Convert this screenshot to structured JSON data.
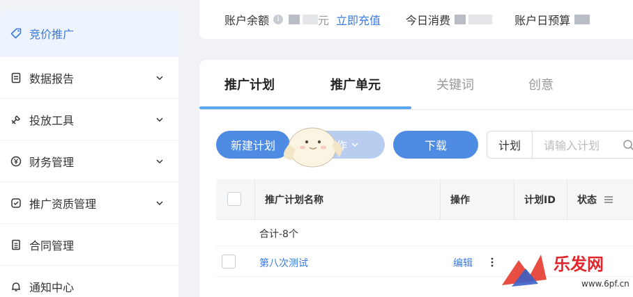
{
  "sidebar": {
    "items": [
      {
        "label": "竞价推广",
        "icon": "tag-icon",
        "active": true
      },
      {
        "label": "数据报告",
        "icon": "report-icon"
      },
      {
        "label": "投放工具",
        "icon": "tool-icon"
      },
      {
        "label": "财务管理",
        "icon": "yen-icon"
      },
      {
        "label": "推广资质管理",
        "icon": "shield-check-icon"
      },
      {
        "label": "合同管理",
        "icon": "document-icon"
      },
      {
        "label": "通知中心",
        "icon": "bell-icon"
      }
    ]
  },
  "topbar": {
    "balance_label": "账户余额",
    "balance_suffix": "元",
    "recharge": "立即充值",
    "today_label": "今日消费",
    "budget_label": "账户日预算"
  },
  "tabs": [
    {
      "label": "推广计划",
      "active": true
    },
    {
      "label": "推广单元"
    },
    {
      "label": "关键词"
    },
    {
      "label": "创意"
    }
  ],
  "toolbar": {
    "new_plan": "新建计划",
    "operate": "操作",
    "download": "下载",
    "scope": "计划",
    "search_placeholder": "请输入计划"
  },
  "table": {
    "headers": {
      "name": "推广计划名称",
      "ops": "操作",
      "id": "计划ID",
      "status": "状态"
    },
    "summary": "合计-8个",
    "rows": [
      {
        "name": "第八次测试",
        "action": "编辑"
      }
    ]
  },
  "watermark": {
    "text": "乐发网",
    "subtext": "www.6pf.cn"
  },
  "colors": {
    "accent": "#3a7ae0",
    "primary_button": "#4e8be3",
    "tab_ink": "#5aa9f0"
  }
}
